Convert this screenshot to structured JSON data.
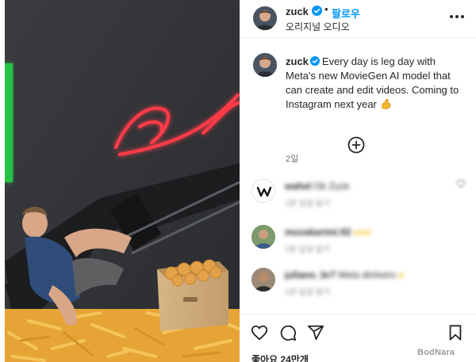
{
  "post": {
    "username": "zuck",
    "follow_label": "팔로우",
    "audio_label": "오리지널 오디오",
    "caption_username": "zuck",
    "caption_text": "Every day is leg day with Meta's new MovieGen AI model that can create and edit videos. Coming to Instagram next year",
    "caption_emoji": "flexed-biceps",
    "time_ago": "2일",
    "likes_text": "좋아요 24만개"
  },
  "comments": [
    {
      "username": "wahel",
      "text": "Ok Zuck",
      "meta": "1분   답글 달기",
      "avatar": "w-logo-avatar"
    },
    {
      "username": "musakarimi.92",
      "text": "",
      "meta": "1분   답글 달기",
      "avatar": "photo-avatar"
    },
    {
      "username": "juliano_br7",
      "text": "Meta dinheiro",
      "meta": "1분   답글 달기",
      "avatar": "photo-avatar"
    }
  ],
  "icons": {
    "verified": "verified-badge-icon",
    "more": "more-options-icon",
    "add_comments": "plus-circle-icon",
    "like": "heart-icon",
    "comment": "comment-icon",
    "share": "share-icon",
    "save": "bookmark-icon"
  },
  "colors": {
    "accent": "#0095f6",
    "neon": "#ff2b3a"
  },
  "watermark": "BodNara"
}
